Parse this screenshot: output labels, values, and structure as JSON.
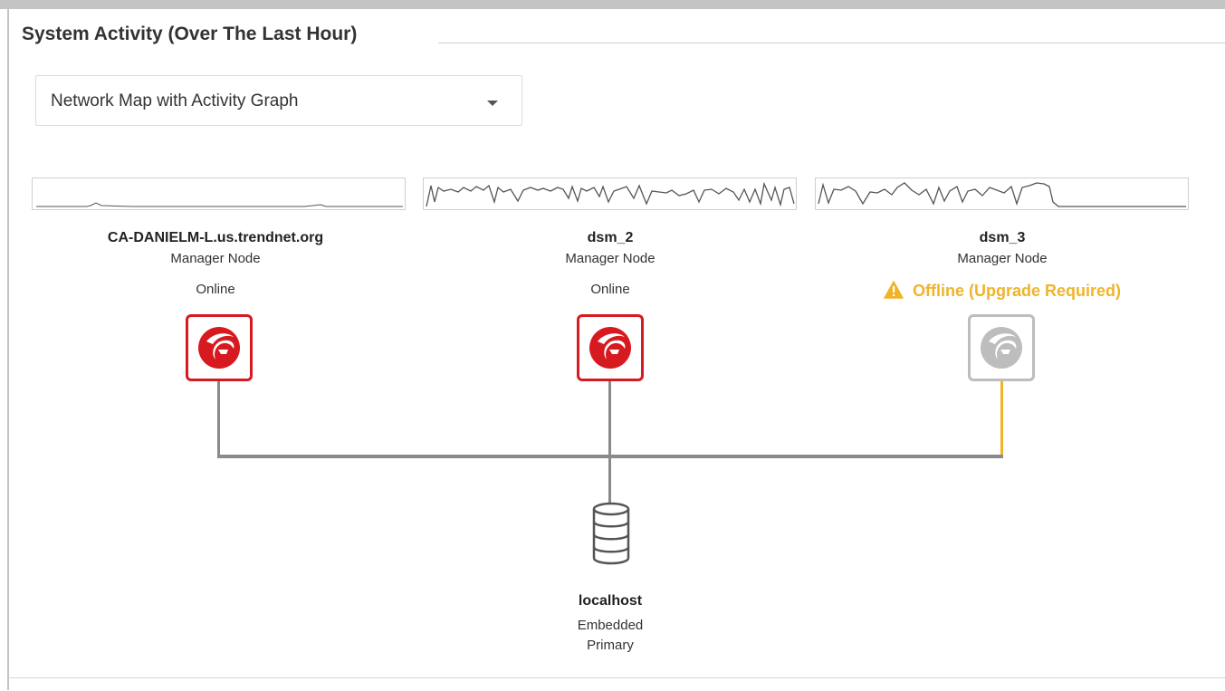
{
  "panel": {
    "title": "System Activity (Over The Last Hour)"
  },
  "view_select": {
    "selected": "Network Map with Activity Graph"
  },
  "nodes": [
    {
      "name": "CA-DANIELM-L.us.trendnet.org",
      "role": "Manager Node",
      "status": "Online",
      "icon": "trend-micro-logo-icon",
      "state": "online"
    },
    {
      "name": "dsm_2",
      "role": "Manager Node",
      "status": "Online",
      "icon": "trend-micro-logo-icon",
      "state": "online"
    },
    {
      "name": "dsm_3",
      "role": "Manager Node",
      "status": "Offline (Upgrade Required)",
      "icon": "trend-micro-logo-icon",
      "state": "offline",
      "status_icon": "warning-icon"
    }
  ],
  "database": {
    "name": "localhost",
    "type": "Embedded",
    "role": "Primary",
    "icon": "database-icon"
  },
  "colors": {
    "online_accent": "#d71920",
    "offline_gray": "#bdbdbd",
    "warning": "#f0b429",
    "link_line": "#8a8a8a",
    "sparkline": "#555555"
  }
}
